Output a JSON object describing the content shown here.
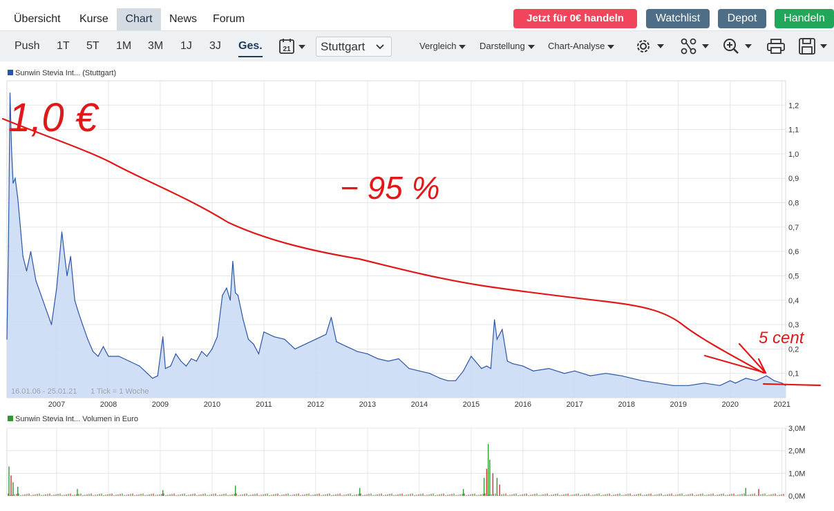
{
  "nav": {
    "tabs": [
      "Übersicht",
      "Kurse",
      "Chart",
      "News",
      "Forum"
    ],
    "active_tab": "Chart",
    "buttons": {
      "trade_promo": "Jetzt für 0€ handeln",
      "watchlist": "Watchlist",
      "depot": "Depot",
      "handeln": "Handeln"
    }
  },
  "toolbar": {
    "ranges": [
      "Push",
      "1T",
      "5T",
      "1M",
      "3M",
      "1J",
      "3J",
      "Ges."
    ],
    "active_range": "Ges.",
    "calendar_day": "21",
    "exchange": "Stuttgart",
    "menus": [
      "Vergleich",
      "Darstellung",
      "Chart-Analyse"
    ],
    "icons": [
      "settings-icon",
      "share-icon",
      "zoom-icon",
      "print-icon",
      "save-icon"
    ]
  },
  "colors": {
    "promo": "#f0455a",
    "watchlist": "#4e6d86",
    "depot": "#4e6d86",
    "handeln": "#22a65a",
    "price_line": "#2a55a5",
    "price_fill": "#c9d9f5",
    "annotation": "#e01818",
    "vol_up": "#2e9a2e",
    "vol_down": "#d33030"
  },
  "chart_data": [
    {
      "type": "area",
      "legend": "Sunwin Stevia Int... (Stuttgart)",
      "date_range_label": "16.01.06 - 25.01.21",
      "tick_label": "1 Tick = 1 Woche",
      "x_ticks": [
        "2007",
        "2008",
        "2009",
        "2010",
        "2011",
        "2012",
        "2013",
        "2014",
        "2015",
        "2016",
        "2017",
        "2018",
        "2019",
        "2020",
        "2021"
      ],
      "y_ticks": [
        "0,1",
        "0,2",
        "0,3",
        "0,4",
        "0,5",
        "0,6",
        "0,7",
        "0,8",
        "0,9",
        "1,0",
        "1,1",
        "1,2"
      ],
      "xlim": [
        2006.04,
        2021.07
      ],
      "ylim": [
        0,
        1.3
      ],
      "grid": true,
      "series": [
        {
          "x": [
            2006.04,
            2006.07,
            2006.1,
            2006.13,
            2006.16,
            2006.2,
            2006.25,
            2006.3,
            2006.35,
            2006.42,
            2006.5,
            2006.6,
            2006.7,
            2006.8,
            2006.9,
            2007.0,
            2007.1,
            2007.2,
            2007.27,
            2007.35,
            2007.42,
            2007.5,
            2007.6,
            2007.7,
            2007.8,
            2007.9,
            2008.0,
            2008.2,
            2008.4,
            2008.6,
            2008.75,
            2008.85,
            2008.95,
            2009.05,
            2009.1,
            2009.2,
            2009.3,
            2009.4,
            2009.5,
            2009.6,
            2009.7,
            2009.8,
            2009.9,
            2010.0,
            2010.1,
            2010.2,
            2010.28,
            2010.35,
            2010.4,
            2010.45,
            2010.5,
            2010.6,
            2010.7,
            2010.8,
            2010.9,
            2011.0,
            2011.2,
            2011.4,
            2011.6,
            2011.8,
            2012.0,
            2012.2,
            2012.3,
            2012.4,
            2012.6,
            2012.8,
            2013.0,
            2013.2,
            2013.4,
            2013.6,
            2013.8,
            2014.0,
            2014.2,
            2014.4,
            2014.55,
            2014.7,
            2014.85,
            2015.0,
            2015.2,
            2015.3,
            2015.38,
            2015.45,
            2015.5,
            2015.6,
            2015.7,
            2015.8,
            2016.0,
            2016.2,
            2016.5,
            2016.8,
            2017.0,
            2017.3,
            2017.6,
            2017.9,
            2018.1,
            2018.3,
            2018.6,
            2018.9,
            2019.2,
            2019.5,
            2019.8,
            2020.0,
            2020.1,
            2020.3,
            2020.5,
            2020.7,
            2020.85,
            2021.0,
            2021.07
          ],
          "y": [
            0.24,
            0.62,
            1.25,
            1.02,
            0.88,
            0.9,
            0.82,
            0.7,
            0.58,
            0.52,
            0.6,
            0.48,
            0.42,
            0.36,
            0.3,
            0.45,
            0.68,
            0.5,
            0.58,
            0.4,
            0.35,
            0.3,
            0.24,
            0.19,
            0.17,
            0.21,
            0.17,
            0.17,
            0.15,
            0.13,
            0.1,
            0.08,
            0.09,
            0.25,
            0.12,
            0.13,
            0.18,
            0.15,
            0.13,
            0.16,
            0.15,
            0.19,
            0.17,
            0.2,
            0.25,
            0.42,
            0.45,
            0.4,
            0.56,
            0.43,
            0.42,
            0.32,
            0.24,
            0.22,
            0.18,
            0.27,
            0.25,
            0.24,
            0.2,
            0.22,
            0.24,
            0.26,
            0.33,
            0.23,
            0.21,
            0.19,
            0.18,
            0.16,
            0.15,
            0.16,
            0.12,
            0.11,
            0.1,
            0.08,
            0.07,
            0.07,
            0.11,
            0.17,
            0.12,
            0.13,
            0.12,
            0.32,
            0.24,
            0.28,
            0.15,
            0.14,
            0.13,
            0.11,
            0.12,
            0.1,
            0.11,
            0.09,
            0.1,
            0.09,
            0.08,
            0.07,
            0.06,
            0.05,
            0.05,
            0.06,
            0.05,
            0.07,
            0.06,
            0.08,
            0.07,
            0.09,
            0.07,
            0.06,
            0.05
          ]
        }
      ]
    },
    {
      "type": "bar",
      "legend": "Sunwin Stevia Int... Volumen in Euro",
      "y_ticks": [
        "0,0M",
        "1,0M",
        "2,0M",
        "3,0M"
      ],
      "ylim": [
        0,
        3
      ],
      "grid": true,
      "spikes": [
        {
          "x": 2006.08,
          "v": 1.3,
          "dir": "up"
        },
        {
          "x": 2006.12,
          "v": 0.9,
          "dir": "down"
        },
        {
          "x": 2006.16,
          "v": 0.6,
          "dir": "up"
        },
        {
          "x": 2006.25,
          "v": 0.4,
          "dir": "up"
        },
        {
          "x": 2007.4,
          "v": 0.3,
          "dir": "up"
        },
        {
          "x": 2009.05,
          "v": 0.25,
          "dir": "up"
        },
        {
          "x": 2010.45,
          "v": 0.45,
          "dir": "up"
        },
        {
          "x": 2012.85,
          "v": 0.35,
          "dir": "up"
        },
        {
          "x": 2014.85,
          "v": 0.3,
          "dir": "up"
        },
        {
          "x": 2015.25,
          "v": 0.8,
          "dir": "up"
        },
        {
          "x": 2015.3,
          "v": 1.2,
          "dir": "down"
        },
        {
          "x": 2015.33,
          "v": 2.3,
          "dir": "up"
        },
        {
          "x": 2015.36,
          "v": 1.6,
          "dir": "up"
        },
        {
          "x": 2015.42,
          "v": 1.0,
          "dir": "down"
        },
        {
          "x": 2015.5,
          "v": 0.8,
          "dir": "up"
        },
        {
          "x": 2015.55,
          "v": 0.5,
          "dir": "down"
        },
        {
          "x": 2020.3,
          "v": 0.35,
          "dir": "up"
        },
        {
          "x": 2020.55,
          "v": 0.3,
          "dir": "down"
        }
      ]
    }
  ],
  "annotations": {
    "top_left": "1,0 €",
    "middle": "− 95 %",
    "bottom_right": "5 cent"
  }
}
